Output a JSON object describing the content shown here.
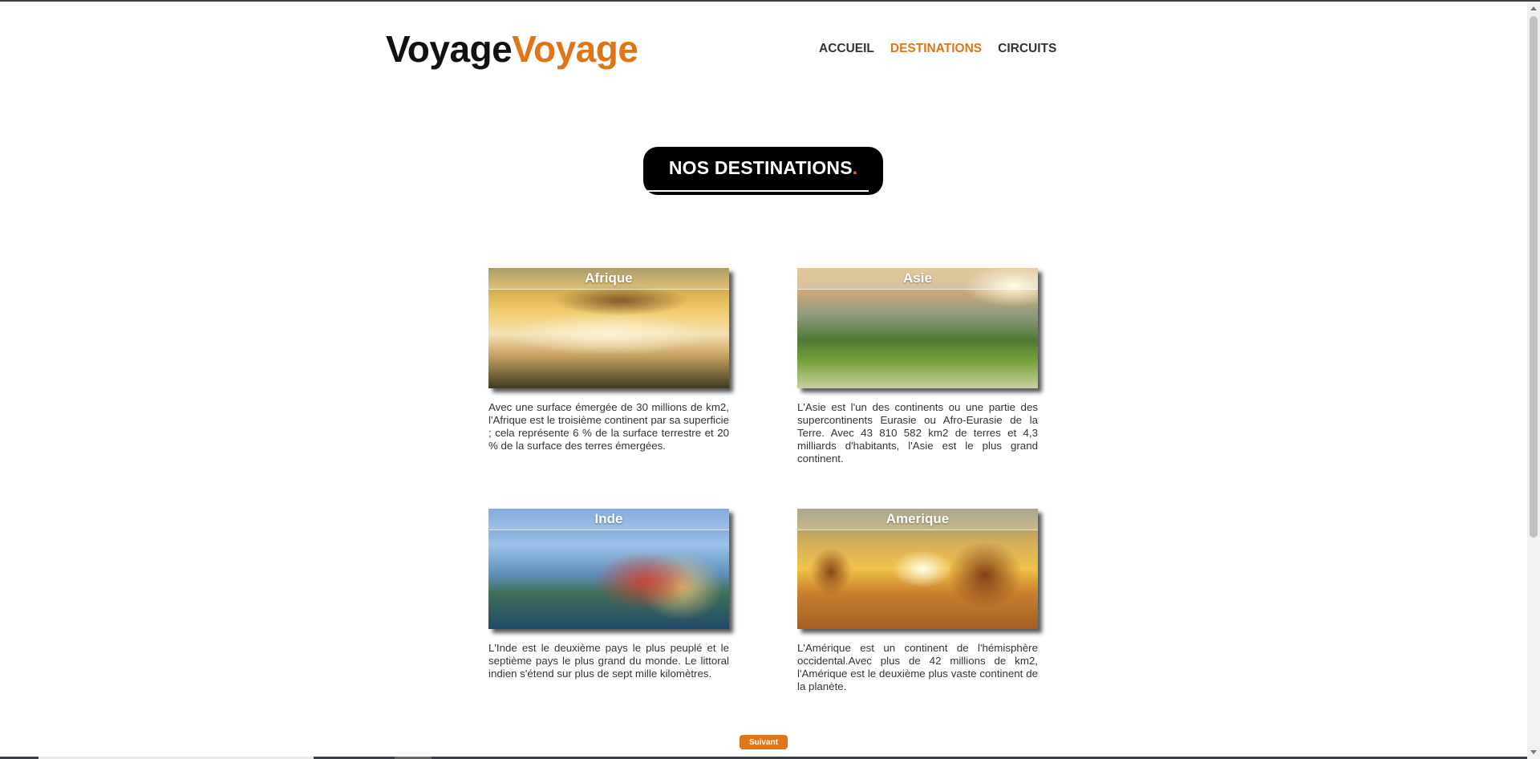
{
  "logo": {
    "part1": "Voyage",
    "part2": "Voyage"
  },
  "nav": {
    "items": [
      {
        "label": "ACCUEIL",
        "active": false
      },
      {
        "label": "DESTINATIONS",
        "active": true
      },
      {
        "label": "CIRCUITS",
        "active": false
      }
    ]
  },
  "title": {
    "text": "NOS DESTINATIONS",
    "dot": "."
  },
  "cards": [
    {
      "label": "Afrique",
      "description": "Avec une surface émergée de 30 millions de km2, l'Afrique est le troisième continent par sa superficie ; cela représente 6 % de la surface terrestre et 20 % de la surface des terres émergées."
    },
    {
      "label": "Asie",
      "description": "L'Asie est l'un des continents ou une partie des supercontinents Eurasie ou Afro-Eurasie de la Terre. Avec 43 810 582 km2 de terres et 4,3 milliards d'habitants, l'Asie est le plus grand continent."
    },
    {
      "label": "Inde",
      "description": "L'Inde est le deuxième pays le plus peuplé et le septième pays le plus grand du monde. Le littoral indien s'étend sur plus de sept mille kilomètres."
    },
    {
      "label": "Amerique",
      "description": "L'Amérique est un continent de l'hémisphère occidental.Avec plus de 42 millions de km2, l'Amérique est le deuxième plus vaste continent de la planète."
    }
  ],
  "next_button": {
    "label": "Suivant"
  },
  "colors": {
    "accent": "#e07417",
    "dark": "#111111",
    "text": "#333333"
  }
}
